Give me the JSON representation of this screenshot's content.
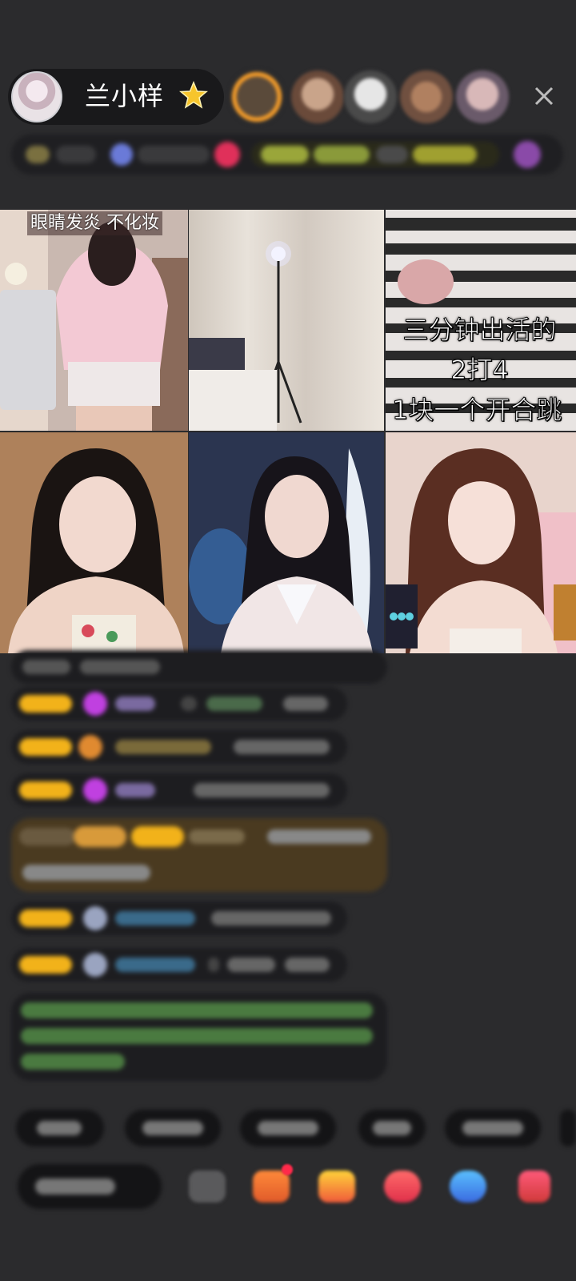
{
  "header": {
    "host_name": "兰小样",
    "star_icon": "star-icon",
    "viewers_count": 5,
    "close_icon": "close-icon"
  },
  "grid": {
    "cells": [
      {
        "caption": "眼睛发炎 不化妆"
      },
      {
        "caption": ""
      },
      {
        "overlay_lines": [
          "三分钟出活的",
          "2打4",
          "1块一个开合跳"
        ]
      },
      {
        "caption": ""
      },
      {
        "caption": ""
      },
      {
        "caption": ""
      }
    ]
  },
  "colors": {
    "background": "#2b2b2d",
    "badge_gold": "#f2b21a",
    "message_bg": "#1d1d20",
    "highlight_msg_bg": "#4a3a20",
    "system_text": "#74c86a"
  },
  "chat": {
    "message_count": 8,
    "blurred": true
  },
  "bottom": {
    "quick_replies_count": 6,
    "input_placeholder_blurred": true,
    "toolbar_icons": [
      "emoji-icon",
      "gift-box-icon",
      "gift-icon",
      "heart-icon",
      "game-icon",
      "more-icon"
    ]
  }
}
